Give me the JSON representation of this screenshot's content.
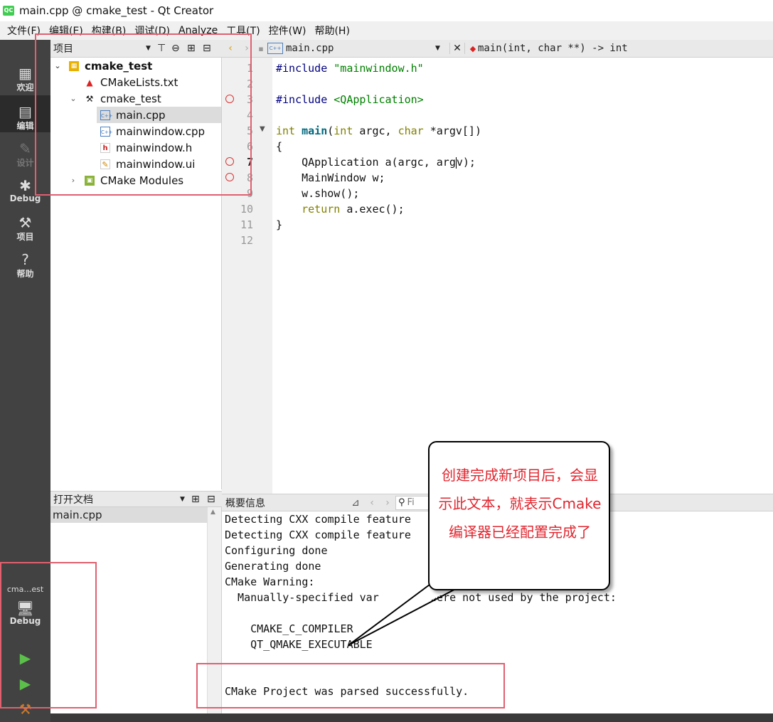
{
  "window": {
    "title": "main.cpp @ cmake_test - Qt Creator",
    "logo": "QC"
  },
  "menu": [
    "文件(F)",
    "编辑(E)",
    "构建(B)",
    "调试(D)",
    "Analyze",
    "工具(T)",
    "控件(W)",
    "帮助(H)"
  ],
  "modes": {
    "welcome": "欢迎",
    "edit": "编辑",
    "design": "设计",
    "debug": "Debug",
    "projects": "项目",
    "help": "帮助"
  },
  "kit": {
    "project": "cma…est",
    "config": "Debug"
  },
  "project_panel": {
    "title": "项目",
    "tree": [
      "cmake_test",
      "CMakeLists.txt",
      "cmake_test",
      "main.cpp",
      "mainwindow.cpp",
      "mainwindow.h",
      "mainwindow.ui",
      "CMake Modules"
    ]
  },
  "open_docs": {
    "title": "打开文档",
    "items": [
      "main.cpp"
    ]
  },
  "editor": {
    "file": "main.cpp",
    "symbol": "main(int, char **) -> int",
    "line_numbers": [
      "1",
      "2",
      "3",
      "4",
      "5",
      "6",
      "7",
      "8",
      "9",
      "10",
      "11",
      "12"
    ],
    "code": {
      "l1_pp": "#include ",
      "l1_str": "\"mainwindow.h\"",
      "l3_pp": "#include ",
      "l3_str": "<QApplication>",
      "l5_kw1": "int ",
      "l5_fn": "main",
      "l5_a": "(",
      "l5_kw2": "int",
      "l5_b": " argc, ",
      "l5_kw3": "char",
      "l5_c": " *argv[])",
      "l6": "{",
      "l7_a": "    QApplication a(argc, arg",
      "l7_b": "v);",
      "l8": "    MainWindow w;",
      "l9": "    w.show();",
      "l10_kw": "    return",
      "l10_b": " a.exec();",
      "l11": "}"
    }
  },
  "output": {
    "title": "概要信息",
    "filter_placeholder": "Fi",
    "lines": [
      "Detecting CXX compile feature",
      "Detecting CXX compile feature",
      "Configuring done",
      "Generating done",
      "CMake Warning:",
      "  Manually-specified var        were not used by the project:",
      "",
      "    CMAKE_C_COMPILER",
      "    QT_QMAKE_EXECUTABLE",
      "",
      "",
      "CMake Project was parsed successfully."
    ]
  },
  "callout": {
    "text": "创建完成新项目后，会显示此文本，就表示Cmake编译器已经配置完成了"
  },
  "colors": {
    "annotation_box": "#e06070",
    "callout_text": "#e0262f",
    "sidebar": "#424242"
  }
}
